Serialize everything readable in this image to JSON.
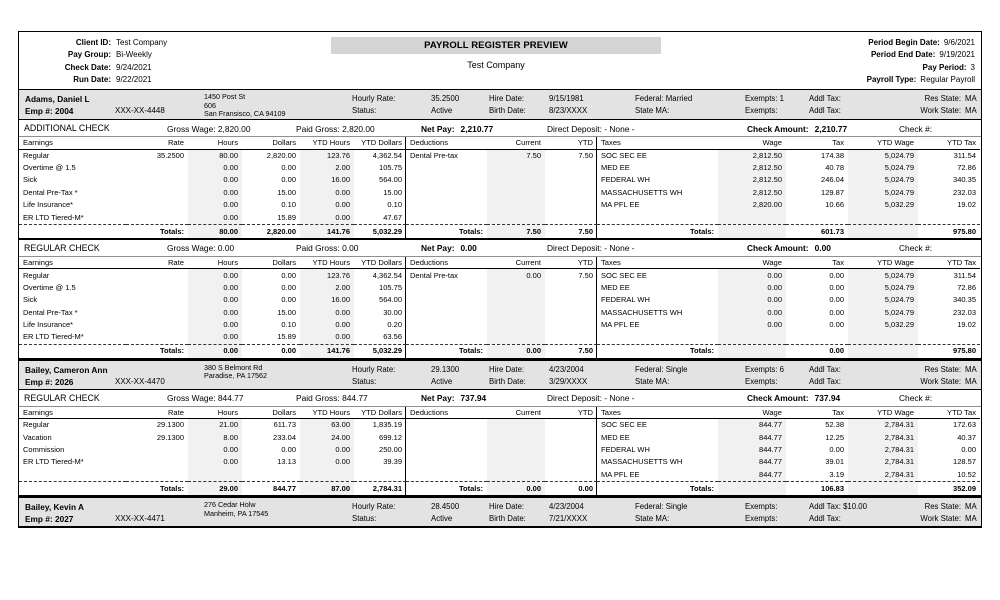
{
  "header": {
    "title": "PAYROLL REGISTER PREVIEW",
    "subtitle": "Test Company",
    "left": [
      {
        "label": "Client ID:",
        "value": "Test Company"
      },
      {
        "label": "Pay Group:",
        "value": "Bi-Weekly"
      },
      {
        "label": "Check Date:",
        "value": "9/24/2021"
      },
      {
        "label": "Run Date:",
        "value": "9/22/2021"
      }
    ],
    "right": [
      {
        "label": "Period Begin Date:",
        "value": "9/6/2021"
      },
      {
        "label": "Period End Date:",
        "value": "9/19/2021"
      },
      {
        "label": "Pay Period:",
        "value": "3"
      },
      {
        "label": "Payroll Type:",
        "value": "Regular Payroll"
      }
    ]
  },
  "columns": {
    "earnings": [
      "Earnings",
      "Rate",
      "Hours",
      "Dollars",
      "YTD Hours",
      "YTD Dollars"
    ],
    "deductions": [
      "Deductions",
      "Current",
      "YTD"
    ],
    "taxes": [
      "Taxes",
      "Wage",
      "Tax",
      "YTD Wage",
      "YTD Tax"
    ],
    "totals_label": "Totals:"
  },
  "labels": {
    "hourly_rate": "Hourly Rate:",
    "status": "Status:",
    "hire_date": "Hire Date:",
    "birth_date": "Birth Date:",
    "federal": "Federal:",
    "state": "State MA:",
    "exempts": "Exempts:",
    "addl_tax": "Addl Tax:",
    "res_state": "Res State:",
    "work_state": "Work State:",
    "emp_num": "Emp #:",
    "gross_wage": "Gross Wage:",
    "paid_gross": "Paid Gross:",
    "net_pay": "Net Pay:",
    "direct_deposit": "Direct Deposit:",
    "check_amount": "Check Amount:",
    "check_no": "Check #:"
  },
  "employees": [
    {
      "name": "Adams, Daniel L",
      "emp_num": "2004",
      "ssn": "XXX-XX-4448",
      "address_line1": "1450 Post St",
      "address_line2": "606",
      "address_line3": "San Fransisco, CA 94109",
      "hourly_rate": "35.2500",
      "status": "Active",
      "hire_date": "9/15/1981",
      "birth_date": "8/23/XXXX",
      "federal": "Married",
      "state": "",
      "exempts_fed": "1",
      "exempts_state": "",
      "addl_tax_fed": "",
      "addl_tax_state": "",
      "res_state": "MA",
      "work_state": "MA",
      "checks": [
        {
          "type": "ADDITIONAL CHECK",
          "gross_wage": "2,820.00",
          "paid_gross": "2,820.00",
          "net_pay": "2,210.77",
          "direct_deposit": "- None -",
          "check_amount": "2,210.77",
          "check_no": "",
          "earnings": [
            {
              "name": "Regular",
              "rate": "35.2500",
              "hours": "80.00",
              "dollars": "2,820.00",
              "ytd_hours": "123.76",
              "ytd_dollars": "4,362.54"
            },
            {
              "name": "Overtime @ 1.5",
              "rate": "",
              "hours": "0.00",
              "dollars": "0.00",
              "ytd_hours": "2.00",
              "ytd_dollars": "105.75"
            },
            {
              "name": "Sick",
              "rate": "",
              "hours": "0.00",
              "dollars": "0.00",
              "ytd_hours": "16.00",
              "ytd_dollars": "564.00"
            },
            {
              "name": "Dental Pre-Tax *",
              "rate": "",
              "hours": "0.00",
              "dollars": "15.00",
              "ytd_hours": "0.00",
              "ytd_dollars": "15.00"
            },
            {
              "name": "Life Insurance*",
              "rate": "",
              "hours": "0.00",
              "dollars": "0.10",
              "ytd_hours": "0.00",
              "ytd_dollars": "0.10"
            },
            {
              "name": "ER LTD Tiered-M*",
              "rate": "",
              "hours": "0.00",
              "dollars": "15.89",
              "ytd_hours": "0.00",
              "ytd_dollars": "47.67"
            }
          ],
          "earnings_totals": {
            "hours": "80.00",
            "dollars": "2,820.00",
            "ytd_hours": "141.76",
            "ytd_dollars": "5,032.29"
          },
          "deductions": [
            {
              "name": "Dental Pre-tax",
              "current": "7.50",
              "ytd": "7.50"
            }
          ],
          "deductions_totals": {
            "current": "7.50",
            "ytd": "7.50"
          },
          "taxes": [
            {
              "name": "SOC SEC EE",
              "wage": "2,812.50",
              "tax": "174.38",
              "ytd_wage": "5,024.79",
              "ytd_tax": "311.54"
            },
            {
              "name": "MED EE",
              "wage": "2,812.50",
              "tax": "40.78",
              "ytd_wage": "5,024.79",
              "ytd_tax": "72.86"
            },
            {
              "name": "FEDERAL WH",
              "wage": "2,812.50",
              "tax": "246.04",
              "ytd_wage": "5,024.79",
              "ytd_tax": "340.35"
            },
            {
              "name": "MASSACHUSETTS WH",
              "wage": "2,812.50",
              "tax": "129.87",
              "ytd_wage": "5,024.79",
              "ytd_tax": "232.03"
            },
            {
              "name": "MA PFL EE",
              "wage": "2,820.00",
              "tax": "10.66",
              "ytd_wage": "5,032.29",
              "ytd_tax": "19.02"
            }
          ],
          "taxes_totals": {
            "wage": "",
            "tax": "601.73",
            "ytd_wage": "",
            "ytd_tax": "975.80"
          }
        },
        {
          "type": "REGULAR CHECK",
          "gross_wage": "0.00",
          "paid_gross": "0.00",
          "net_pay": "0.00",
          "direct_deposit": "- None -",
          "check_amount": "0.00",
          "check_no": "",
          "earnings": [
            {
              "name": "Regular",
              "rate": "",
              "hours": "0.00",
              "dollars": "0.00",
              "ytd_hours": "123.76",
              "ytd_dollars": "4,362.54"
            },
            {
              "name": "Overtime @ 1.5",
              "rate": "",
              "hours": "0.00",
              "dollars": "0.00",
              "ytd_hours": "2.00",
              "ytd_dollars": "105.75"
            },
            {
              "name": "Sick",
              "rate": "",
              "hours": "0.00",
              "dollars": "0.00",
              "ytd_hours": "16.00",
              "ytd_dollars": "564.00"
            },
            {
              "name": "Dental Pre-Tax *",
              "rate": "",
              "hours": "0.00",
              "dollars": "15.00",
              "ytd_hours": "0.00",
              "ytd_dollars": "30.00"
            },
            {
              "name": "Life Insurance*",
              "rate": "",
              "hours": "0.00",
              "dollars": "0.10",
              "ytd_hours": "0.00",
              "ytd_dollars": "0.20"
            },
            {
              "name": "ER LTD Tiered-M*",
              "rate": "",
              "hours": "0.00",
              "dollars": "15.89",
              "ytd_hours": "0.00",
              "ytd_dollars": "63.56"
            }
          ],
          "earnings_totals": {
            "hours": "0.00",
            "dollars": "0.00",
            "ytd_hours": "141.76",
            "ytd_dollars": "5,032.29"
          },
          "deductions": [
            {
              "name": "Dental Pre-tax",
              "current": "0.00",
              "ytd": "7.50"
            }
          ],
          "deductions_totals": {
            "current": "0.00",
            "ytd": "7.50"
          },
          "taxes": [
            {
              "name": "SOC SEC EE",
              "wage": "0.00",
              "tax": "0.00",
              "ytd_wage": "5,024.79",
              "ytd_tax": "311.54"
            },
            {
              "name": "MED EE",
              "wage": "0.00",
              "tax": "0.00",
              "ytd_wage": "5,024.79",
              "ytd_tax": "72.86"
            },
            {
              "name": "FEDERAL WH",
              "wage": "0.00",
              "tax": "0.00",
              "ytd_wage": "5,024.79",
              "ytd_tax": "340.35"
            },
            {
              "name": "MASSACHUSETTS WH",
              "wage": "0.00",
              "tax": "0.00",
              "ytd_wage": "5,024.79",
              "ytd_tax": "232.03"
            },
            {
              "name": "MA PFL EE",
              "wage": "0.00",
              "tax": "0.00",
              "ytd_wage": "5,032.29",
              "ytd_tax": "19.02"
            }
          ],
          "taxes_totals": {
            "wage": "",
            "tax": "0.00",
            "ytd_wage": "",
            "ytd_tax": "975.80"
          }
        }
      ]
    },
    {
      "name": "Bailey, Cameron Ann",
      "emp_num": "2026",
      "ssn": "XXX-XX-4470",
      "address_line1": "380 S Belmont Rd",
      "address_line2": "Paradise, PA 17562",
      "address_line3": "",
      "hourly_rate": "29.1300",
      "status": "Active",
      "hire_date": "4/23/2004",
      "birth_date": "3/29/XXXX",
      "federal": "Single",
      "state": "",
      "exempts_fed": "6",
      "exempts_state": "",
      "addl_tax_fed": "",
      "addl_tax_state": "",
      "res_state": "MA",
      "work_state": "MA",
      "checks": [
        {
          "type": "REGULAR CHECK",
          "gross_wage": "844.77",
          "paid_gross": "844.77",
          "net_pay": "737.94",
          "direct_deposit": "- None -",
          "check_amount": "737.94",
          "check_no": "",
          "earnings": [
            {
              "name": "Regular",
              "rate": "29.1300",
              "hours": "21.00",
              "dollars": "611.73",
              "ytd_hours": "63.00",
              "ytd_dollars": "1,835.19"
            },
            {
              "name": "Vacation",
              "rate": "29.1300",
              "hours": "8.00",
              "dollars": "233.04",
              "ytd_hours": "24.00",
              "ytd_dollars": "699.12"
            },
            {
              "name": "Commission",
              "rate": "",
              "hours": "0.00",
              "dollars": "0.00",
              "ytd_hours": "0.00",
              "ytd_dollars": "250.00"
            },
            {
              "name": "ER LTD Tiered-M*",
              "rate": "",
              "hours": "0.00",
              "dollars": "13.13",
              "ytd_hours": "0.00",
              "ytd_dollars": "39.39"
            }
          ],
          "earnings_totals": {
            "hours": "29.00",
            "dollars": "844.77",
            "ytd_hours": "87.00",
            "ytd_dollars": "2,784.31"
          },
          "deductions": [],
          "deductions_totals": {
            "current": "0.00",
            "ytd": "0.00"
          },
          "taxes": [
            {
              "name": "SOC SEC EE",
              "wage": "844.77",
              "tax": "52.38",
              "ytd_wage": "2,784.31",
              "ytd_tax": "172.63"
            },
            {
              "name": "MED EE",
              "wage": "844.77",
              "tax": "12.25",
              "ytd_wage": "2,784.31",
              "ytd_tax": "40.37"
            },
            {
              "name": "FEDERAL WH",
              "wage": "844.77",
              "tax": "0.00",
              "ytd_wage": "2,784.31",
              "ytd_tax": "0.00"
            },
            {
              "name": "MASSACHUSETTS WH",
              "wage": "844.77",
              "tax": "39.01",
              "ytd_wage": "2,784.31",
              "ytd_tax": "128.57"
            },
            {
              "name": "MA PFL EE",
              "wage": "844.77",
              "tax": "3.19",
              "ytd_wage": "2,784.31",
              "ytd_tax": "10.52"
            }
          ],
          "taxes_totals": {
            "wage": "",
            "tax": "106.83",
            "ytd_wage": "",
            "ytd_tax": "352.09"
          }
        }
      ]
    },
    {
      "name": "Bailey, Kevin A",
      "emp_num": "2027",
      "ssn": "XXX-XX-4471",
      "address_line1": "276 Cedar Holw",
      "address_line2": "Manheim, PA 17545",
      "address_line3": "",
      "hourly_rate": "28.4500",
      "status": "Active",
      "hire_date": "4/23/2004",
      "birth_date": "7/21/XXXX",
      "federal": "Single",
      "state": "",
      "exempts_fed": "",
      "exempts_state": "",
      "addl_tax_fed": "$10.00",
      "addl_tax_state": "",
      "res_state": "MA",
      "work_state": "MA",
      "checks": []
    }
  ]
}
